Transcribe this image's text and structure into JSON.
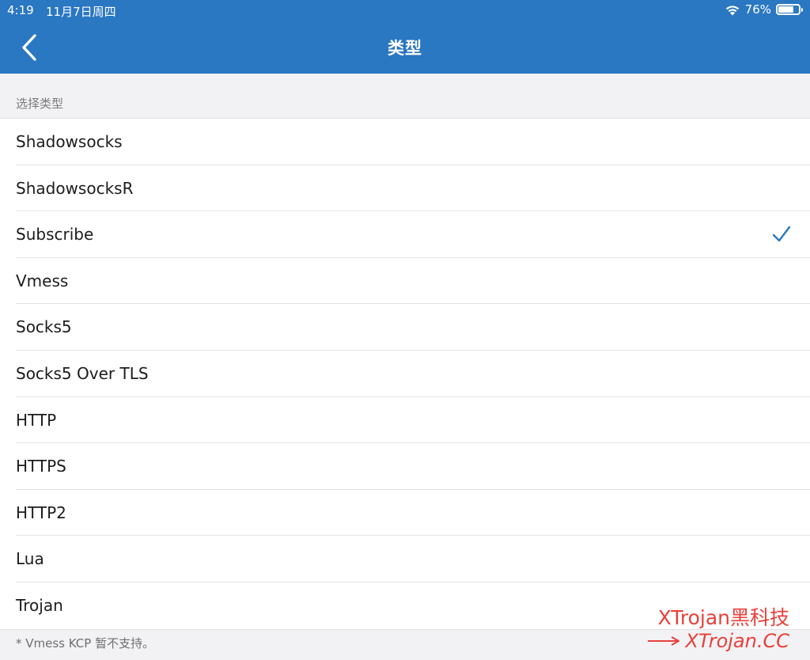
{
  "status_bar": {
    "time": "4:19",
    "date": "11月7日周四",
    "battery_percent": "76%",
    "battery_level": 0.76
  },
  "nav": {
    "title": "类型",
    "back_icon": "chevron-left-icon"
  },
  "section": {
    "header": "选择类型"
  },
  "types": [
    {
      "label": "Shadowsocks",
      "selected": false
    },
    {
      "label": "ShadowsocksR",
      "selected": false
    },
    {
      "label": "Subscribe",
      "selected": true
    },
    {
      "label": "Vmess",
      "selected": false
    },
    {
      "label": "Socks5",
      "selected": false
    },
    {
      "label": "Socks5 Over TLS",
      "selected": false
    },
    {
      "label": "HTTP",
      "selected": false
    },
    {
      "label": "HTTPS",
      "selected": false
    },
    {
      "label": "HTTP2",
      "selected": false
    },
    {
      "label": "Lua",
      "selected": false
    },
    {
      "label": "Trojan",
      "selected": false
    }
  ],
  "footer": {
    "note": "* Vmess KCP 暂不支持。"
  },
  "watermark": {
    "line1": "XTrojan黑科技",
    "line2": "XTrojan.CC"
  },
  "colors": {
    "header_bg": "#2a77c2",
    "accent": "#2a77c2",
    "watermark": "#e8413b"
  }
}
